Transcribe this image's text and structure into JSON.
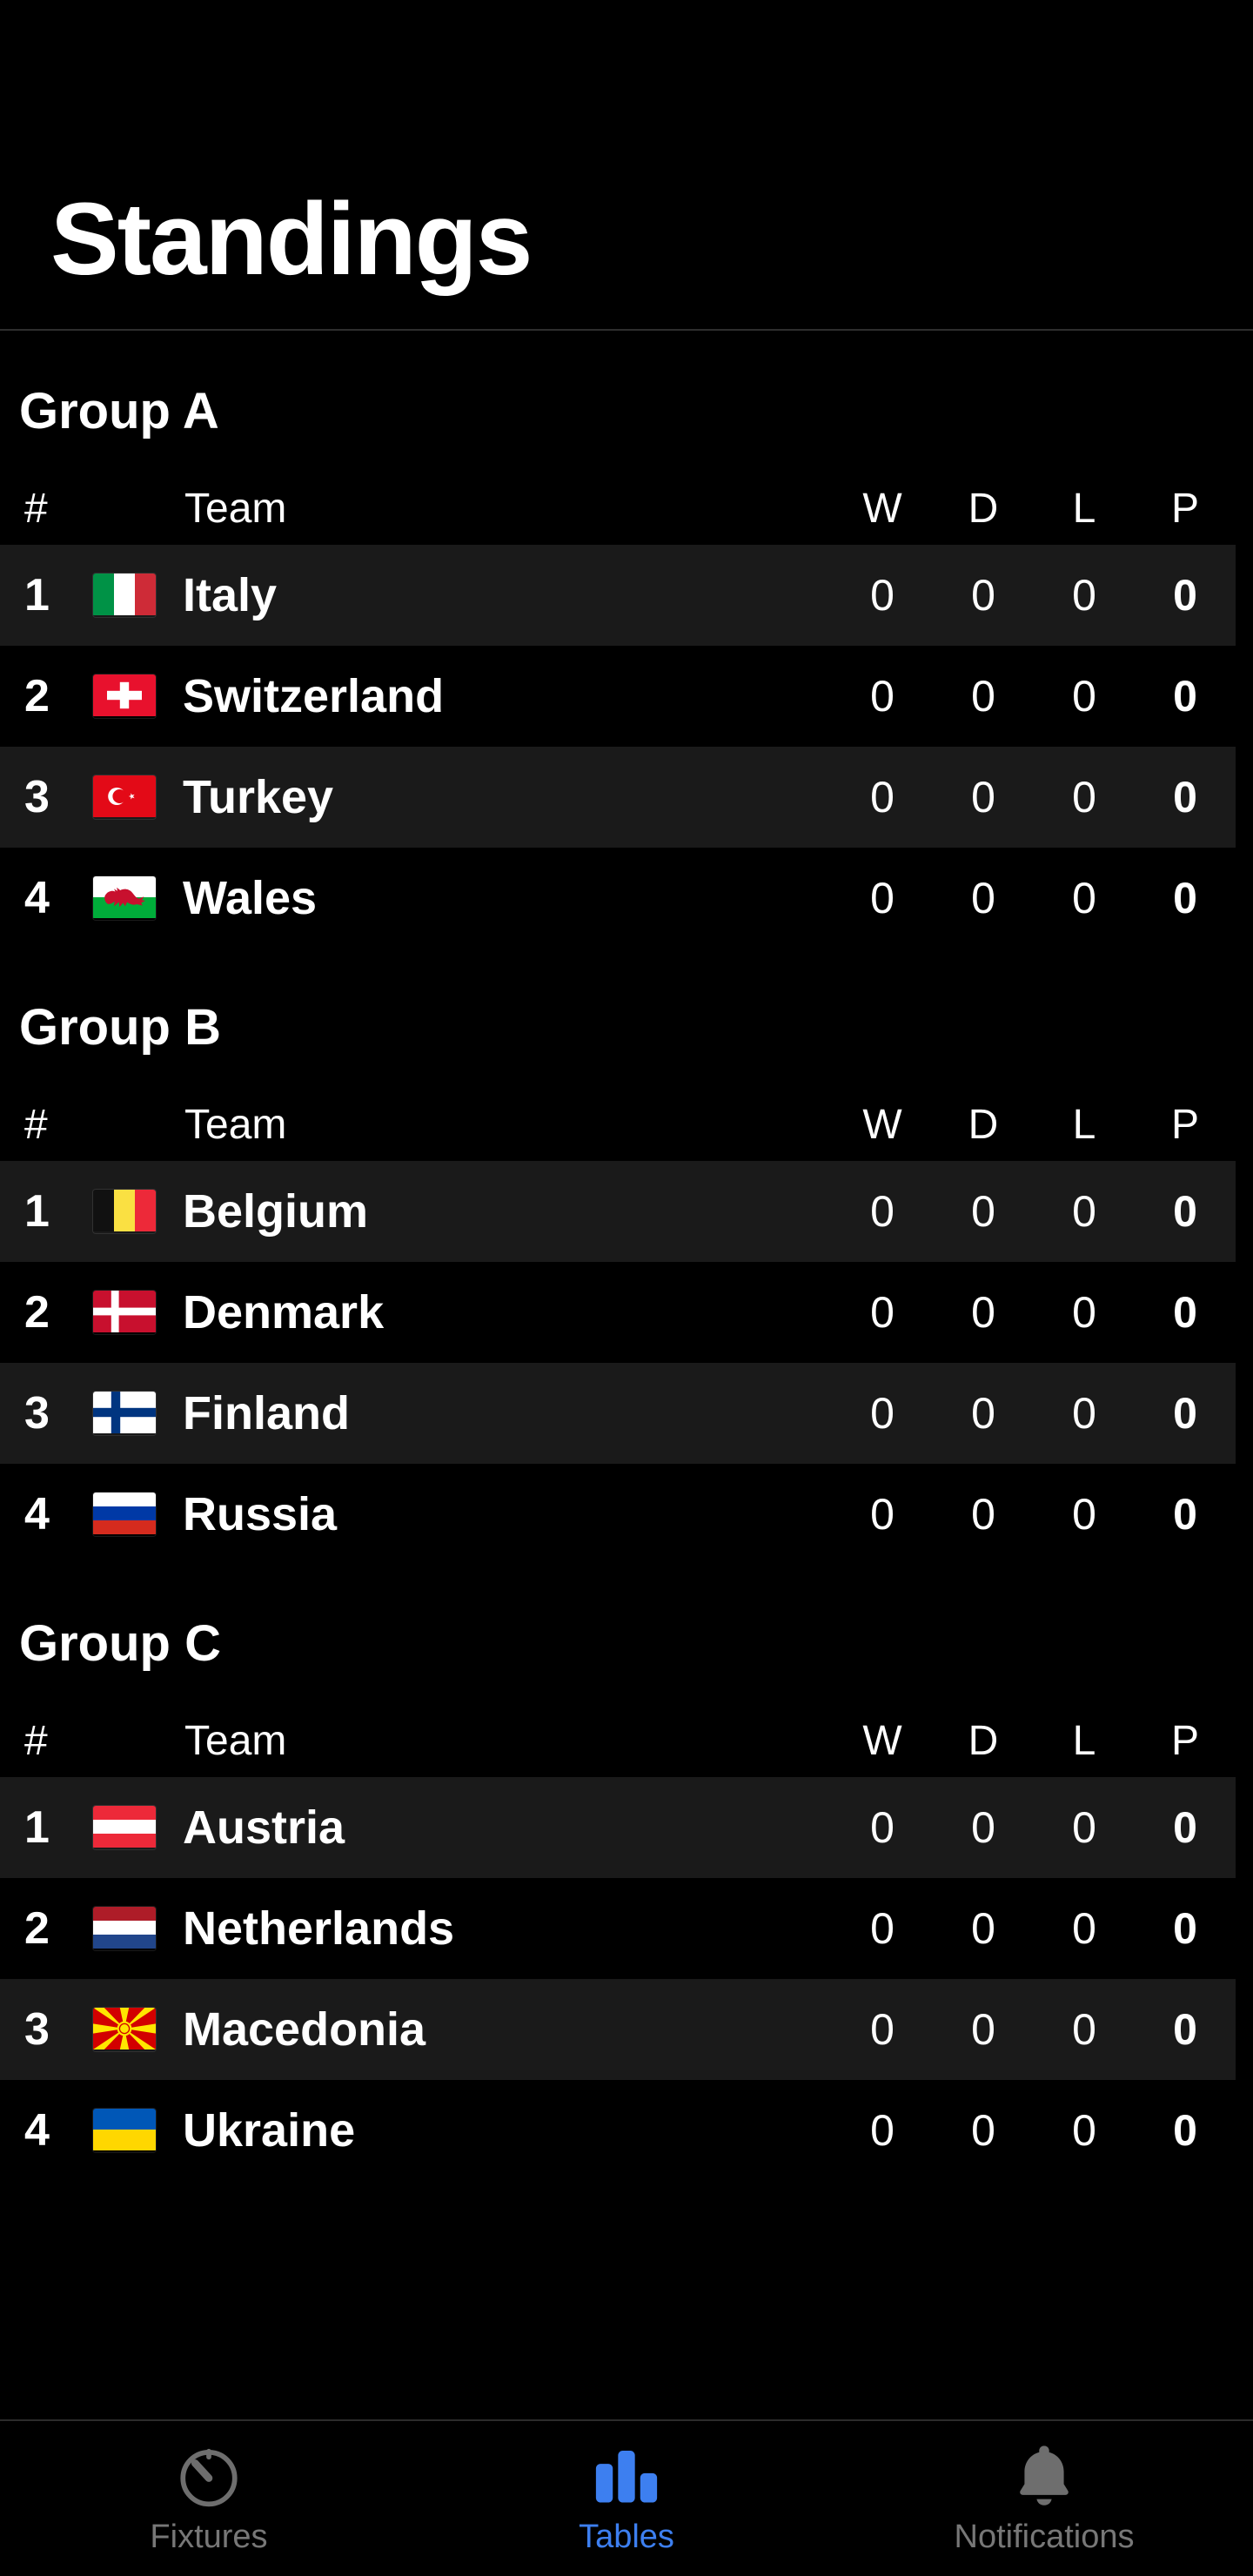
{
  "header": {
    "title": "Standings"
  },
  "colors": {
    "background": "#000000",
    "row_stripe": "#1a1a1a",
    "text": "#ffffff",
    "accent": "#3d7ff0",
    "inactive": "#777777",
    "divider": "#2e2e2e"
  },
  "columns": {
    "rank": "#",
    "team": "Team",
    "w": "W",
    "d": "D",
    "l": "L",
    "p": "P"
  },
  "groups": [
    {
      "title": "Group A",
      "rows": [
        {
          "rank": "1",
          "team": "Italy",
          "flag": "flag-italy",
          "w": "0",
          "d": "0",
          "l": "0",
          "p": "0"
        },
        {
          "rank": "2",
          "team": "Switzerland",
          "flag": "flag-switzerland",
          "w": "0",
          "d": "0",
          "l": "0",
          "p": "0"
        },
        {
          "rank": "3",
          "team": "Turkey",
          "flag": "flag-turkey",
          "w": "0",
          "d": "0",
          "l": "0",
          "p": "0"
        },
        {
          "rank": "4",
          "team": "Wales",
          "flag": "flag-wales",
          "w": "0",
          "d": "0",
          "l": "0",
          "p": "0"
        }
      ]
    },
    {
      "title": "Group B",
      "rows": [
        {
          "rank": "1",
          "team": "Belgium",
          "flag": "flag-belgium",
          "w": "0",
          "d": "0",
          "l": "0",
          "p": "0"
        },
        {
          "rank": "2",
          "team": "Denmark",
          "flag": "flag-denmark",
          "w": "0",
          "d": "0",
          "l": "0",
          "p": "0"
        },
        {
          "rank": "3",
          "team": "Finland",
          "flag": "flag-finland",
          "w": "0",
          "d": "0",
          "l": "0",
          "p": "0"
        },
        {
          "rank": "4",
          "team": "Russia",
          "flag": "flag-russia",
          "w": "0",
          "d": "0",
          "l": "0",
          "p": "0"
        }
      ]
    },
    {
      "title": "Group C",
      "rows": [
        {
          "rank": "1",
          "team": "Austria",
          "flag": "flag-austria",
          "w": "0",
          "d": "0",
          "l": "0",
          "p": "0"
        },
        {
          "rank": "2",
          "team": "Netherlands",
          "flag": "flag-netherlands",
          "w": "0",
          "d": "0",
          "l": "0",
          "p": "0"
        },
        {
          "rank": "3",
          "team": "Macedonia",
          "flag": "flag-macedonia",
          "w": "0",
          "d": "0",
          "l": "0",
          "p": "0"
        },
        {
          "rank": "4",
          "team": "Ukraine",
          "flag": "flag-ukraine",
          "w": "0",
          "d": "0",
          "l": "0",
          "p": "0"
        }
      ]
    }
  ],
  "tabbar": {
    "items": [
      {
        "label": "Fixtures",
        "icon": "stopwatch-icon",
        "active": false
      },
      {
        "label": "Tables",
        "icon": "bar-chart-icon",
        "active": true
      },
      {
        "label": "Notifications",
        "icon": "bell-icon",
        "active": false
      }
    ]
  }
}
